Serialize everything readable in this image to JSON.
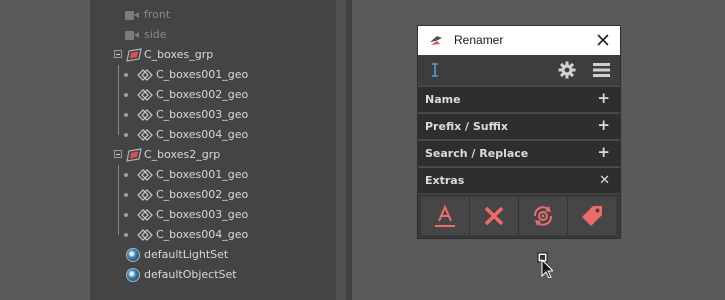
{
  "outliner": {
    "cameras": [
      {
        "label": "front"
      },
      {
        "label": "side"
      }
    ],
    "groups": [
      {
        "label": "C_boxes_grp",
        "children": [
          "C_boxes001_geo",
          "C_boxes002_geo",
          "C_boxes003_geo",
          "C_boxes004_geo"
        ]
      },
      {
        "label": "C_boxes2_grp",
        "children": [
          "C_boxes001_geo",
          "C_boxes002_geo",
          "C_boxes003_geo",
          "C_boxes004_geo"
        ]
      }
    ],
    "sets": [
      {
        "label": "defaultLightSet"
      },
      {
        "label": "defaultObjectSet"
      }
    ]
  },
  "renamer": {
    "title": "Renamer",
    "icons": {
      "app": "renamer-logo-icon",
      "close": "close-icon",
      "text_cursor": "text-cursor-icon",
      "settings": "gear-icon",
      "menu": "hamburger-menu-icon"
    },
    "sections": [
      {
        "label": "Name",
        "icon": "plus-icon",
        "symbol": "+"
      },
      {
        "label": "Prefix / Suffix",
        "icon": "plus-icon",
        "symbol": "+"
      },
      {
        "label": "Search / Replace",
        "icon": "plus-icon",
        "symbol": "+"
      },
      {
        "label": "Extras",
        "icon": "close-icon",
        "symbol": "✕"
      }
    ],
    "extras_buttons": [
      {
        "icon": "letter-underline-icon"
      },
      {
        "icon": "delete-x-icon"
      },
      {
        "icon": "cycle-gear-icon"
      },
      {
        "icon": "tag-icon"
      }
    ],
    "accent_color": "#ee6b6b",
    "cursor_color": "#4aa3df"
  }
}
